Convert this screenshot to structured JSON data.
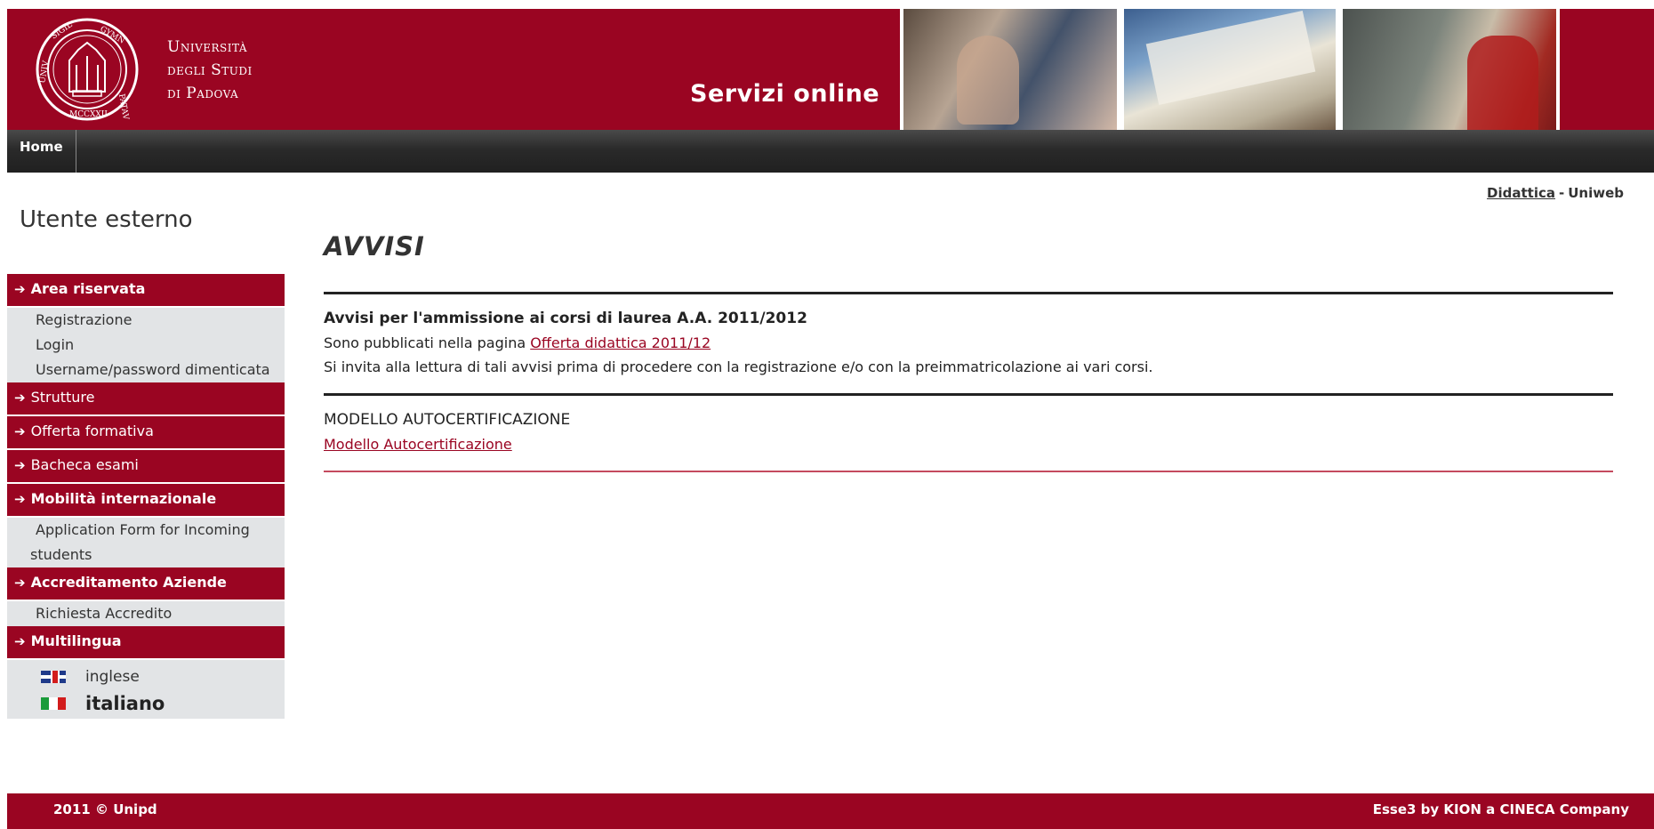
{
  "header": {
    "university_lines": [
      "Università",
      "degli Studi",
      "di Padova"
    ],
    "service_title": "Servizi online",
    "brand_color": "#9a0522"
  },
  "navbar": {
    "home_label": "Home"
  },
  "breadcrumb": {
    "link": "Didattica",
    "separator": "-",
    "current": "Uniweb"
  },
  "sidebar": {
    "user_title": "Utente esterno",
    "sections": [
      {
        "label": "Area riservata",
        "items": [
          "Registrazione",
          "Login",
          "Username/password dimenticata"
        ]
      },
      {
        "label": "Strutture",
        "items": []
      },
      {
        "label": "Offerta formativa",
        "items": []
      },
      {
        "label": "Bacheca esami",
        "items": []
      },
      {
        "label": "Mobilità internazionale",
        "items": [
          "Application Form for Incoming students"
        ]
      },
      {
        "label": "Accreditamento Aziende",
        "items": [
          "Richiesta Accredito"
        ]
      },
      {
        "label": "Multilingua",
        "items": []
      }
    ],
    "languages": [
      {
        "label": "inglese",
        "icon": "uk-flag-icon"
      },
      {
        "label": "italiano",
        "icon": "italy-flag-icon",
        "selected": true
      }
    ]
  },
  "main": {
    "title": "AVVISI",
    "notices": [
      {
        "title": "Avvisi per l'ammissione ai corsi di laurea A.A. 2011/2012",
        "line1_prefix": "Sono pubblicati nella pagina",
        "line1_link": "Offerta didattica 2011/12",
        "line2": "Si invita alla lettura di tali avvisi prima di procedere con la registrazione e/o con la preimmatricolazione ai vari corsi."
      },
      {
        "title": "MODELLO AUTOCERTIFICAZIONE",
        "link": "Modello Autocertificazione"
      }
    ]
  },
  "footer": {
    "left": "2011 © Unipd",
    "right": "Esse3 by KION a CINECA Company"
  }
}
